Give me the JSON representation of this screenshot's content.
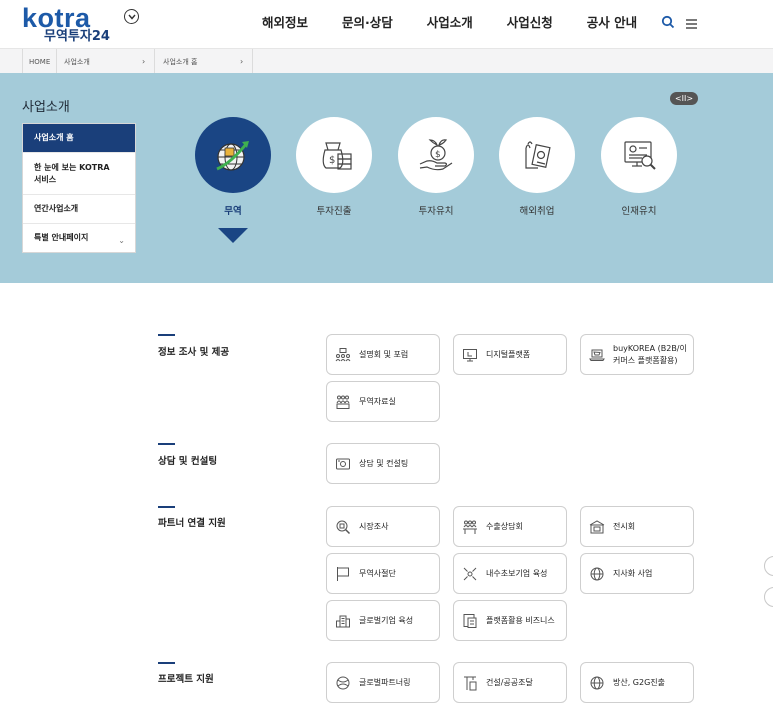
{
  "header": {
    "logo_main": "kotra",
    "logo_sub": "무역투자24",
    "nav": [
      "해외정보",
      "문의·상담",
      "사업소개",
      "사업신청",
      "공사 안내"
    ],
    "icons": [
      "chevron-down-icon",
      "search-icon",
      "menu-icon"
    ],
    "accent": "#1d5aa8"
  },
  "breadcrumb": [
    "HOME",
    "사업소개",
    "사업소개 홈"
  ],
  "hero": {
    "title": "사업소개",
    "pause_label": "<II>",
    "side_menu": [
      "사업소개 홈",
      "한 눈에 보는 KOTRA 서비스",
      "연간사업소개",
      "특별 안내페이지"
    ],
    "categories": [
      "무역",
      "투자진출",
      "투자유치",
      "해외취업",
      "인재유치"
    ],
    "active_category": "무역",
    "bg_color": "#a4cbd9",
    "active_color": "#1a4584"
  },
  "sections": [
    {
      "title": "정보 조사 및 제공",
      "items": [
        "설명회 및 포럼",
        "디지털플랫폼",
        "buyKOREA (B2B/이커머스 플랫폼활용)",
        "무역자료실"
      ]
    },
    {
      "title": "상담 및 컨설팅",
      "items": [
        "상담 및 컨설팅"
      ]
    },
    {
      "title": "파트너 연결 지원",
      "items": [
        "시장조사",
        "수출상담회",
        "전시회",
        "무역사절단",
        "내수초보기업 육성",
        "지사화 사업",
        "글로벌기업 육성",
        "플랫폼활용 비즈니스"
      ]
    },
    {
      "title": "프로젝트 지원",
      "items": [
        "글로벌파트너링",
        "건설/공공조달",
        "방산, G2G진출"
      ]
    }
  ]
}
